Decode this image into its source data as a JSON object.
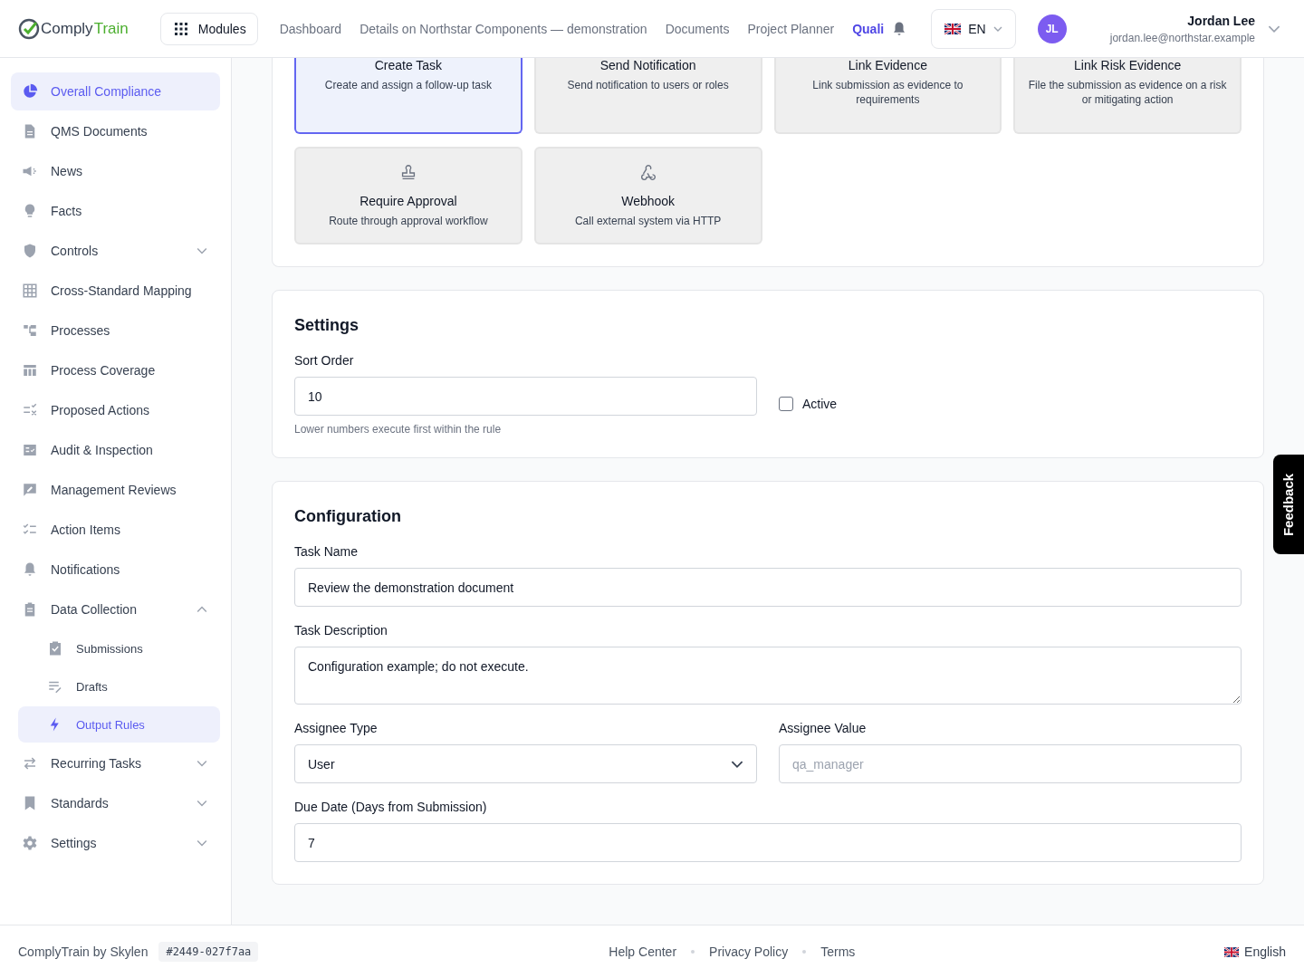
{
  "header": {
    "logo": {
      "first": "Comply",
      "second": "Train"
    },
    "modules_button": "Modules",
    "nav": [
      {
        "label": "Dashboard",
        "selected": false
      },
      {
        "label": "Details on Northstar Components — demonstration",
        "selected": false
      },
      {
        "label": "Documents",
        "selected": false
      },
      {
        "label": "Project Planner",
        "selected": false
      },
      {
        "label": "Quali",
        "selected": true
      }
    ],
    "language": "EN",
    "user": {
      "initials": "JL",
      "name": "Jordan Lee",
      "email": "jordan.lee@northstar.example"
    }
  },
  "sidebar": {
    "items": [
      {
        "label": "Overall Compliance",
        "kind": "compliance",
        "selected": true
      },
      {
        "label": "QMS Documents",
        "kind": "documents",
        "selected": false
      },
      {
        "label": "News",
        "kind": "news",
        "selected": false
      },
      {
        "label": "Facts",
        "kind": "facts",
        "selected": false
      },
      {
        "label": "Controls",
        "kind": "controls",
        "selected": false,
        "expanded": false
      },
      {
        "label": "Cross-Standard Mapping",
        "kind": "mapping",
        "selected": false
      },
      {
        "label": "Processes",
        "kind": "processes",
        "selected": false
      },
      {
        "label": "Process Coverage",
        "kind": "coverage",
        "selected": false
      },
      {
        "label": "Proposed Actions",
        "kind": "proposed",
        "selected": false
      },
      {
        "label": "Audit & Inspection",
        "kind": "audit",
        "selected": false
      },
      {
        "label": "Management Reviews",
        "kind": "reviews",
        "selected": false
      },
      {
        "label": "Action Items",
        "kind": "actions",
        "selected": false
      },
      {
        "label": "Notifications",
        "kind": "notifications",
        "selected": false
      },
      {
        "label": "Data Collection",
        "kind": "collection",
        "selected": false,
        "expanded": true,
        "children": [
          {
            "label": "Submissions",
            "kind": "submissions",
            "selected": false
          },
          {
            "label": "Drafts",
            "kind": "drafts",
            "selected": false
          },
          {
            "label": "Output Rules",
            "kind": "rules",
            "selected": true
          }
        ]
      },
      {
        "label": "Recurring Tasks",
        "kind": "recurring",
        "selected": false,
        "expanded": false
      },
      {
        "label": "Standards",
        "kind": "standards",
        "selected": false,
        "expanded": false
      },
      {
        "label": "Settings",
        "kind": "settings",
        "selected": false,
        "expanded": false
      }
    ]
  },
  "action_types": [
    {
      "title": "Create Task",
      "description": "Create and assign a follow-up task",
      "selected": true
    },
    {
      "title": "Send Notification",
      "description": "Send notification to users or roles",
      "selected": false
    },
    {
      "title": "Link Evidence",
      "description": "Link submission as evidence to requirements",
      "selected": false
    },
    {
      "title": "Link Risk Evidence",
      "description": "File the submission as evidence on a risk or mitigating action",
      "selected": false
    },
    {
      "title": "Require Approval",
      "description": "Route through approval workflow",
      "kind": "approval",
      "selected": false
    },
    {
      "title": "Webhook",
      "description": "Call external system via HTTP",
      "kind": "webhook",
      "selected": false
    }
  ],
  "settings": {
    "title": "Settings",
    "sort_order": {
      "label": "Sort Order",
      "value": "10",
      "hint": "Lower numbers execute first within the rule"
    },
    "active": {
      "label": "Active",
      "checked": false
    }
  },
  "configuration": {
    "title": "Configuration",
    "task_name": {
      "label": "Task Name",
      "value": "Review the demonstration document"
    },
    "task_description": {
      "label": "Task Description",
      "value": "Configuration example; do not execute."
    },
    "assignee_type": {
      "label": "Assignee Type",
      "value": "User"
    },
    "assignee_value": {
      "label": "Assignee Value",
      "placeholder": "qa_manager"
    },
    "due_date": {
      "label": "Due Date (Days from Submission)",
      "value": "7"
    }
  },
  "feedback_tab": "Feedback",
  "footer": {
    "brand": "ComplyTrain by Skylen",
    "build": "#2449-027f7aa",
    "links": [
      "Help Center",
      "Privacy Policy",
      "Terms"
    ],
    "language": "English"
  }
}
